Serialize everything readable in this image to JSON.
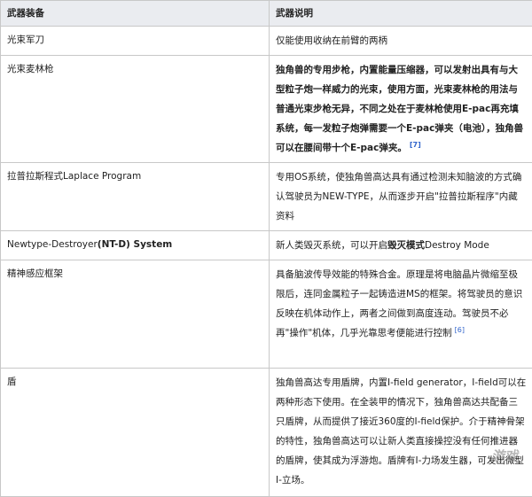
{
  "header": {
    "col1": "武器装备",
    "col2": "武器说明"
  },
  "rows": [
    {
      "name": "光束军刀",
      "desc": "仅能使用收纳在前臂的两柄"
    },
    {
      "name": "光束麦林枪",
      "desc": "独角兽的专用步枪，内置能量压缩器，可以发射出具有与大型粒子炮一样威力的光束，使用方面，光束麦林枪的用法与普通光束步枪无异，不同之处在于麦林枪使用E-pac再充填系统，每一发粒子炮弹需要一个E-pac弹夹（电池），独角兽可以在腰间带十个E-pac弹夹。",
      "ref": "[7]"
    },
    {
      "name": "拉普拉斯程式Laplace Program",
      "desc": "专用OS系统，使独角兽高达具有通过检测未知脑波的方式确认驾驶员为NEW-TYPE，从而逐步开启\"拉普拉斯程序\"内藏资料"
    },
    {
      "name_a": "Newtype-Destroyer",
      "name_b": "(NT-D) System",
      "desc_a": "新人类毁灭系统，可以开启",
      "desc_b": "毁灭模式",
      "desc_c": "Destroy Mode"
    },
    {
      "name": "精神感应框架",
      "desc": "具备脑波传导效能的特殊合金。原理是将电脑晶片微缩至极限后，连同金属粒子一起铸造进MS的框架。将驾驶员的意识反映在机体动作上，两者之间做到高度连动。驾驶员不必再\"操作\"机体，几乎光靠思考便能进行控制",
      "ref": "[6]"
    },
    {
      "name": "盾",
      "desc": "独角兽高达专用盾牌，内置I-field generator，I-field可以在两种形态下使用。在全装甲的情况下，独角兽高达共配备三只盾牌，从而提供了接近360度的I-field保护。介于精神骨架的特性，独角兽高达可以让新人类直接操控没有任何推进器的盾牌，使其成为浮游炮。盾牌有I-力场发生器，可发出微型I-立场。"
    }
  ],
  "watermark": "游戏"
}
